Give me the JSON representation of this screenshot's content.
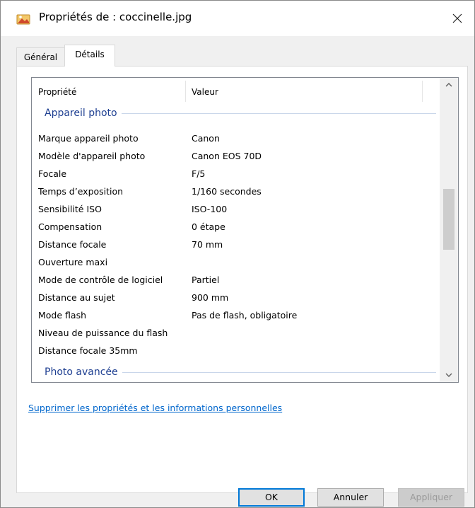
{
  "window": {
    "title": "Propriétés de : coccinelle.jpg",
    "title_icon": "image-file-icon",
    "close_icon": "close-icon"
  },
  "tabs": [
    {
      "label": "Général",
      "active": false
    },
    {
      "label": "Détails",
      "active": true
    }
  ],
  "list": {
    "headers": {
      "property": "Propriété",
      "value": "Valeur"
    },
    "groups": [
      {
        "title": "Appareil photo"
      },
      {
        "title": "Photo avancée"
      }
    ],
    "rows": [
      {
        "name": "Marque appareil photo",
        "value": "Canon"
      },
      {
        "name": "Modèle d'appareil photo",
        "value": "Canon EOS 70D"
      },
      {
        "name": "Focale",
        "value": "F/5"
      },
      {
        "name": "Temps d’exposition",
        "value": "1/160 secondes"
      },
      {
        "name": "Sensibilité ISO",
        "value": "ISO-100"
      },
      {
        "name": "Compensation",
        "value": "0 étape"
      },
      {
        "name": "Distance focale",
        "value": "70 mm"
      },
      {
        "name": "Ouverture maxi",
        "value": ""
      },
      {
        "name": "Mode de contrôle de logiciel",
        "value": "Partiel"
      },
      {
        "name": "Distance au sujet",
        "value": "900 mm"
      },
      {
        "name": "Mode flash",
        "value": "Pas de flash, obligatoire"
      },
      {
        "name": "Niveau de puissance du flash",
        "value": ""
      },
      {
        "name": "Distance focale 35mm",
        "value": ""
      }
    ],
    "scroll_position": 0.45
  },
  "remove_link": "Supprimer les propriétés et les informations personnelles",
  "buttons": {
    "ok": "OK",
    "cancel": "Annuler",
    "apply": "Appliquer",
    "apply_enabled": false
  },
  "colors": {
    "group_title": "#1e3f91",
    "link": "#0066cc",
    "focus_border": "#0078d7"
  }
}
